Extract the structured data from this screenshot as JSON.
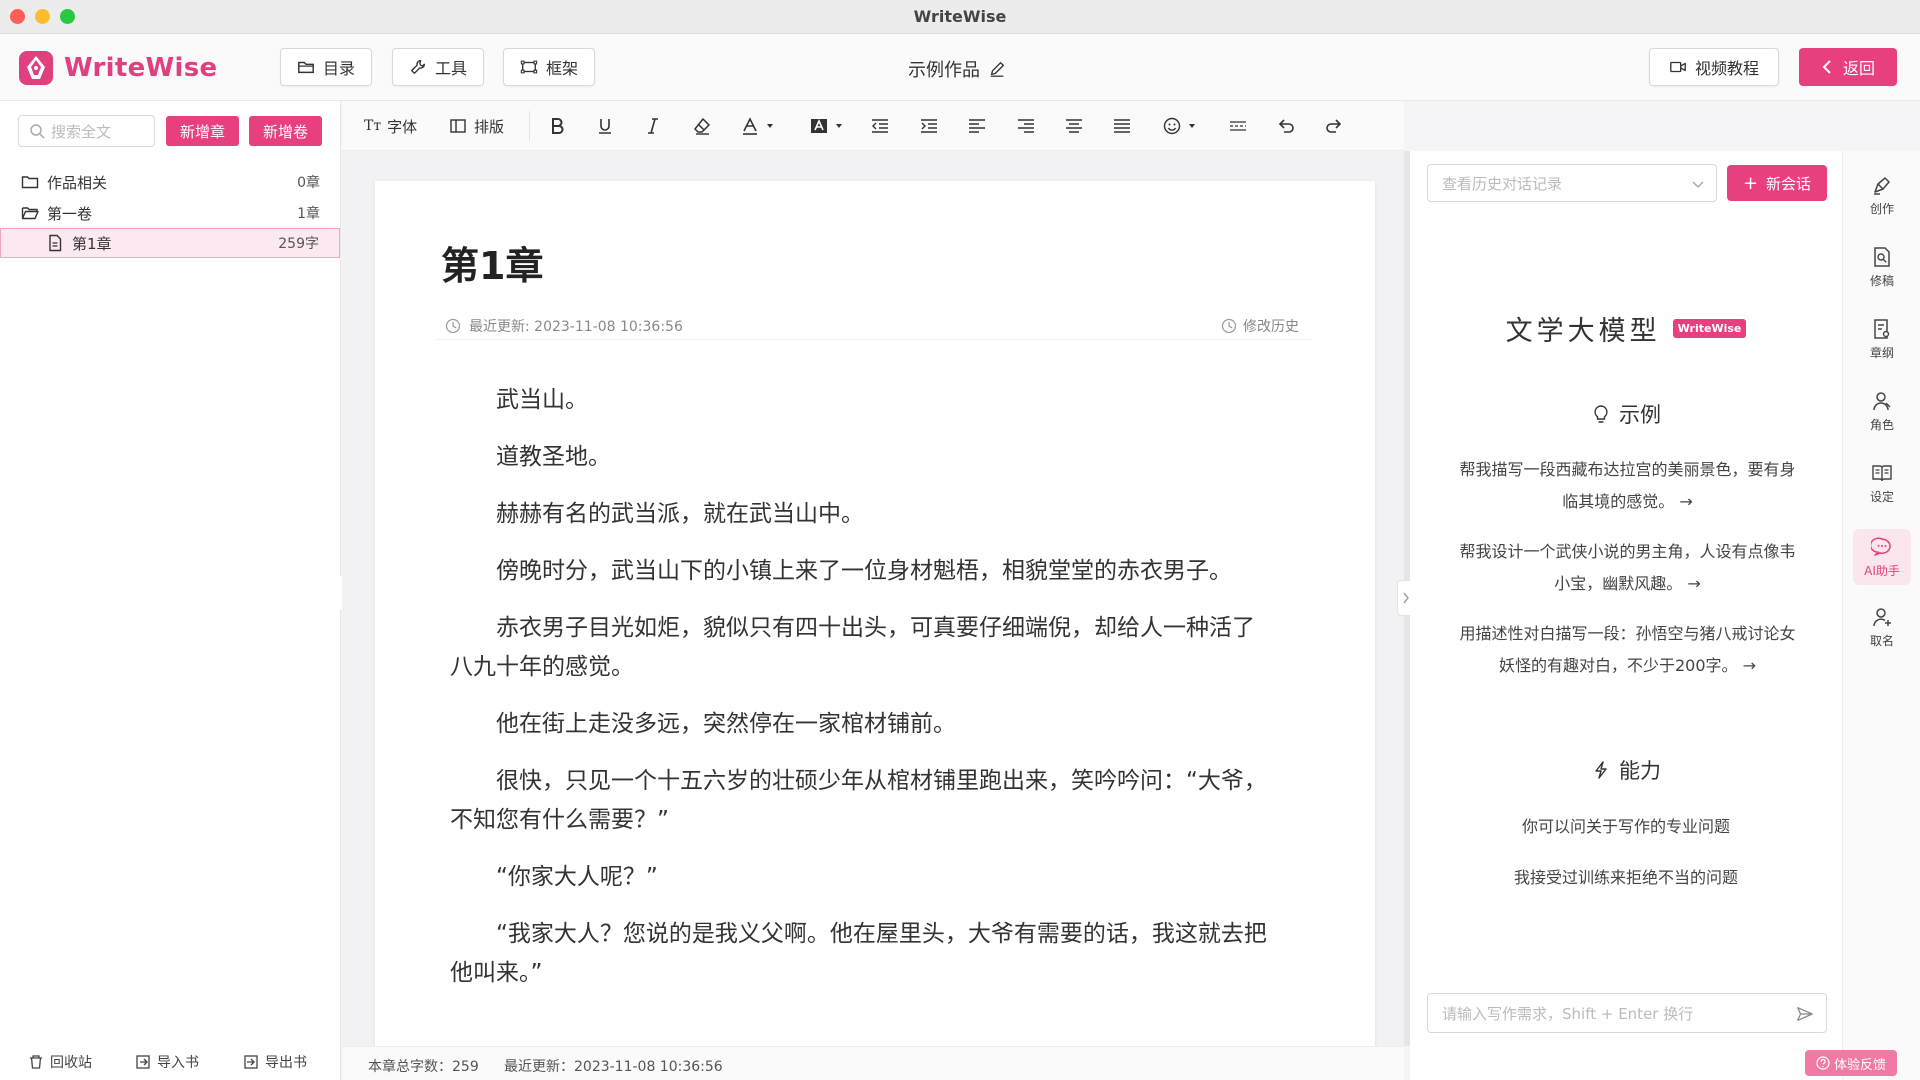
{
  "window": {
    "title": "WriteWise"
  },
  "header": {
    "logo_text": "WriteWise",
    "btn_catalog": "目录",
    "btn_tools": "工具",
    "btn_frame": "框架",
    "work_title": "示例作品",
    "btn_video": "视频教程",
    "btn_back": "返回"
  },
  "sidebar": {
    "search_placeholder": "搜索全文",
    "btn_new_chapter": "新增章",
    "btn_new_volume": "新增卷",
    "tree": [
      {
        "label": "作品相关",
        "count": "0章"
      },
      {
        "label": "第一卷",
        "count": "1章"
      },
      {
        "label": "第1章",
        "count": "259字"
      }
    ],
    "footer": {
      "recycle": "回收站",
      "import": "导入书",
      "export": "导出书"
    }
  },
  "toolbar": {
    "font": "字体",
    "layout": "排版",
    "font_icon_text": "Tт"
  },
  "editor": {
    "chapter_title": "第1章",
    "last_update": "最近更新: 2023-11-08 10:36:56",
    "history": "修改历史",
    "paragraphs": [
      "武当山。",
      "道教圣地。",
      "赫赫有名的武当派，就在武当山中。",
      "傍晚时分，武当山下的小镇上来了一位身材魁梧，相貌堂堂的赤衣男子。",
      "赤衣男子目光如炬，貌似只有四十出头，可真要仔细端倪，却给人一种活了八九十年的感觉。",
      "他在街上走没多远，突然停在一家棺材铺前。",
      "很快，只见一个十五六岁的壮硕少年从棺材铺里跑出来，笑吟吟问：“大爷，不知您有什么需要？”",
      "“你家大人呢？”",
      "“我家大人？您说的是我义父啊。他在屋里头，大爷有需要的话，我这就去把他叫来。”"
    ]
  },
  "statusbar": {
    "word_count": "本章总字数：259",
    "last_update": "最近更新：2023-11-08 10:36:56"
  },
  "ai": {
    "history_placeholder": "查看历史对话记录",
    "new_chat": "新会话",
    "model_title": "文学大模型",
    "badge": "WriteWise",
    "examples_head": "示例",
    "examples": [
      "帮我描写一段西藏布达拉宫的美丽景色，要有身临其境的感觉。 →",
      "帮我设计一个武侠小说的男主角，人设有点像韦小宝，幽默风趣。 →",
      "用描述性对白描写一段：孙悟空与猪八戒讨论女妖怪的有趣对白，不少于200字。 →"
    ],
    "abilities_head": "能力",
    "abilities": [
      "你可以问关于写作的专业问题",
      "我接受过训练来拒绝不当的问题"
    ],
    "prompt_placeholder": "请输入写作需求，Shift + Enter 换行",
    "feedback": "体验反馈"
  },
  "rail": [
    {
      "label": "创作",
      "icon": "pen-nib-icon"
    },
    {
      "label": "修稿",
      "icon": "doc-search-icon"
    },
    {
      "label": "章纲",
      "icon": "doc-outline-icon"
    },
    {
      "label": "角色",
      "icon": "person-icon"
    },
    {
      "label": "设定",
      "icon": "book-icon"
    },
    {
      "label": "AI助手",
      "icon": "chat-icon"
    },
    {
      "label": "取名",
      "icon": "person-add-icon"
    }
  ],
  "colors": {
    "accent": "#e83f7f",
    "accent_light": "#fbe6ee"
  }
}
